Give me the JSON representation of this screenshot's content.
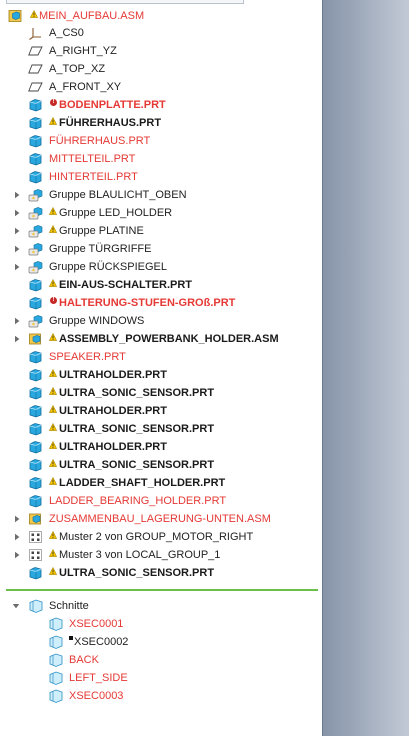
{
  "tree": {
    "root": {
      "label": "MEIN_AUFBAU.ASM"
    },
    "items": [
      {
        "label": "A_CS0",
        "icon": "csys-icon",
        "style": "normal"
      },
      {
        "label": "A_RIGHT_YZ",
        "icon": "datum-plane-icon",
        "style": "normal"
      },
      {
        "label": "A_TOP_XZ",
        "icon": "datum-plane-icon",
        "style": "normal"
      },
      {
        "label": "A_FRONT_XY",
        "icon": "datum-plane-icon",
        "style": "normal"
      },
      {
        "label": "BODENPLATTE.PRT",
        "icon": "part-icon",
        "style": "boldred",
        "marker": "error"
      },
      {
        "label": "FÜHRERHAUS.PRT",
        "icon": "part-icon",
        "style": "bold",
        "marker": "warning"
      },
      {
        "label": "FÜHRERHAUS.PRT",
        "icon": "part-icon",
        "style": "red"
      },
      {
        "label": "MITTELTEIL.PRT",
        "icon": "part-icon",
        "style": "red"
      },
      {
        "label": "HINTERTEIL.PRT",
        "icon": "part-icon",
        "style": "red"
      },
      {
        "label": "Gruppe BLAULICHT_OBEN",
        "icon": "group-icon",
        "style": "normal",
        "expander": true
      },
      {
        "label": "Gruppe LED_HOLDER",
        "icon": "group-icon",
        "style": "normal",
        "expander": true,
        "marker": "warning"
      },
      {
        "label": "Gruppe PLATINE",
        "icon": "group-icon",
        "style": "normal",
        "expander": true,
        "marker": "warning"
      },
      {
        "label": "Gruppe TÜRGRIFFE",
        "icon": "group-icon",
        "style": "normal",
        "expander": true
      },
      {
        "label": "Gruppe RÜCKSPIEGEL",
        "icon": "group-icon",
        "style": "normal",
        "expander": true
      },
      {
        "label": "EIN-AUS-SCHALTER.PRT",
        "icon": "part-icon",
        "style": "bold",
        "marker": "warning"
      },
      {
        "label": "HALTERUNG-STUFEN-GROß.PRT",
        "icon": "part-icon",
        "style": "boldred",
        "marker": "error"
      },
      {
        "label": "Gruppe WINDOWS",
        "icon": "group-icon",
        "style": "normal",
        "expander": true
      },
      {
        "label": "ASSEMBLY_POWERBANK_HOLDER.ASM",
        "icon": "assembly-icon",
        "style": "bold",
        "expander": true,
        "marker": "warning"
      },
      {
        "label": "SPEAKER.PRT",
        "icon": "part-icon",
        "style": "red"
      },
      {
        "label": "ULTRAHOLDER.PRT",
        "icon": "part-icon",
        "style": "bold",
        "marker": "warning"
      },
      {
        "label": "ULTRA_SONIC_SENSOR.PRT",
        "icon": "part-icon",
        "style": "bold",
        "marker": "warning"
      },
      {
        "label": "ULTRAHOLDER.PRT",
        "icon": "part-icon",
        "style": "bold",
        "marker": "warning"
      },
      {
        "label": "ULTRA_SONIC_SENSOR.PRT",
        "icon": "part-icon",
        "style": "bold",
        "marker": "warning"
      },
      {
        "label": "ULTRAHOLDER.PRT",
        "icon": "part-icon",
        "style": "bold",
        "marker": "warning"
      },
      {
        "label": "ULTRA_SONIC_SENSOR.PRT",
        "icon": "part-icon",
        "style": "bold",
        "marker": "warning"
      },
      {
        "label": "LADDER_SHAFT_HOLDER.PRT",
        "icon": "part-icon",
        "style": "bold",
        "marker": "warning"
      },
      {
        "label": "LADDER_BEARING_HOLDER.PRT",
        "icon": "part-icon",
        "style": "red"
      },
      {
        "label": "ZUSAMMENBAU_LAGERUNG-UNTEN.ASM",
        "icon": "assembly-icon",
        "style": "red",
        "expander": true
      },
      {
        "label": "Muster 2 von GROUP_MOTOR_RIGHT",
        "icon": "pattern-icon",
        "style": "normal",
        "expander": true,
        "marker": "warning"
      },
      {
        "label": "Muster 3 von LOCAL_GROUP_1",
        "icon": "pattern-icon",
        "style": "normal",
        "expander": true,
        "marker": "warning"
      },
      {
        "label": "ULTRA_SONIC_SENSOR.PRT",
        "icon": "part-icon",
        "style": "bold",
        "marker": "warning"
      }
    ]
  },
  "sections": {
    "header": {
      "label": "Schnitte"
    },
    "items": [
      {
        "label": "XSEC0001",
        "style": "red"
      },
      {
        "label": "XSEC0002",
        "style": "normal",
        "marker": "square"
      },
      {
        "label": "BACK",
        "style": "red"
      },
      {
        "label": "LEFT_SIDE",
        "style": "red"
      },
      {
        "label": "XSEC0003",
        "style": "red"
      }
    ]
  },
  "colors": {
    "error_red": "#e53935",
    "divider_green": "#6cbf4a",
    "part_blue": "#29a8e0",
    "warning_yellow": "#f5c400"
  }
}
